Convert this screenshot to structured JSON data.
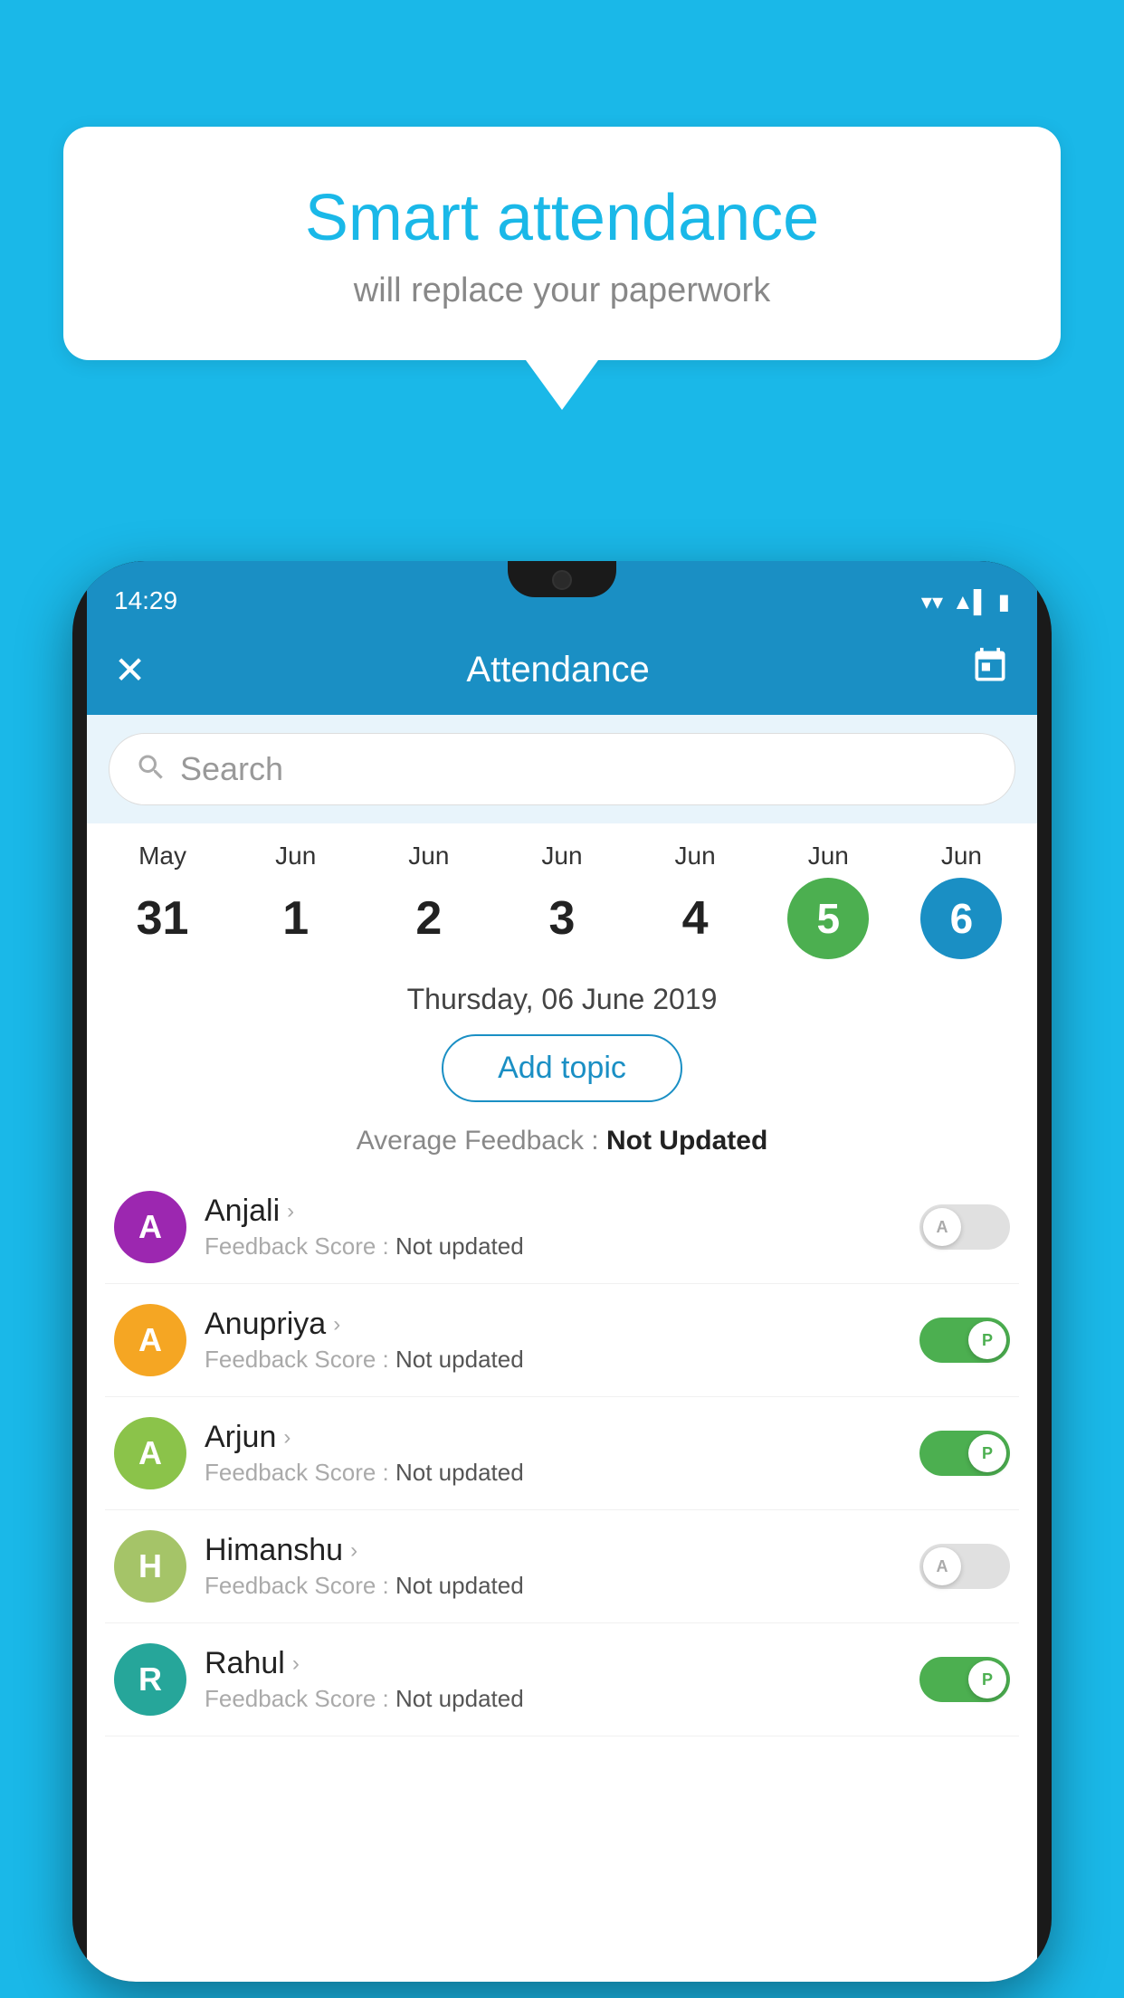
{
  "background_color": "#1ab8e8",
  "speech_bubble": {
    "title": "Smart attendance",
    "subtitle": "will replace your paperwork"
  },
  "status_bar": {
    "time": "14:29",
    "wifi": "▼",
    "signal": "▲",
    "battery": "▮"
  },
  "app_header": {
    "close_label": "✕",
    "title": "Attendance",
    "calendar_icon": "📅"
  },
  "search": {
    "placeholder": "Search"
  },
  "date_strip": {
    "dates": [
      {
        "month": "May",
        "day": "31",
        "style": "normal"
      },
      {
        "month": "Jun",
        "day": "1",
        "style": "normal"
      },
      {
        "month": "Jun",
        "day": "2",
        "style": "normal"
      },
      {
        "month": "Jun",
        "day": "3",
        "style": "normal"
      },
      {
        "month": "Jun",
        "day": "4",
        "style": "normal"
      },
      {
        "month": "Jun",
        "day": "5",
        "style": "green"
      },
      {
        "month": "Jun",
        "day": "6",
        "style": "blue"
      }
    ]
  },
  "selected_date": "Thursday, 06 June 2019",
  "add_topic_label": "Add topic",
  "avg_feedback": {
    "label": "Average Feedback :",
    "value": "Not Updated"
  },
  "students": [
    {
      "name": "Anjali",
      "avatar_letter": "A",
      "avatar_color": "#9c27b0",
      "score_label": "Feedback Score :",
      "score_value": "Not updated",
      "toggle": "off",
      "toggle_label": "A"
    },
    {
      "name": "Anupriya",
      "avatar_letter": "A",
      "avatar_color": "#f5a623",
      "score_label": "Feedback Score :",
      "score_value": "Not updated",
      "toggle": "on",
      "toggle_label": "P"
    },
    {
      "name": "Arjun",
      "avatar_letter": "A",
      "avatar_color": "#8bc34a",
      "score_label": "Feedback Score :",
      "score_value": "Not updated",
      "toggle": "on",
      "toggle_label": "P"
    },
    {
      "name": "Himanshu",
      "avatar_letter": "H",
      "avatar_color": "#a5c468",
      "score_label": "Feedback Score :",
      "score_value": "Not updated",
      "toggle": "off",
      "toggle_label": "A"
    },
    {
      "name": "Rahul",
      "avatar_letter": "R",
      "avatar_color": "#26a69a",
      "score_label": "Feedback Score :",
      "score_value": "Not updated",
      "toggle": "on",
      "toggle_label": "P"
    }
  ]
}
